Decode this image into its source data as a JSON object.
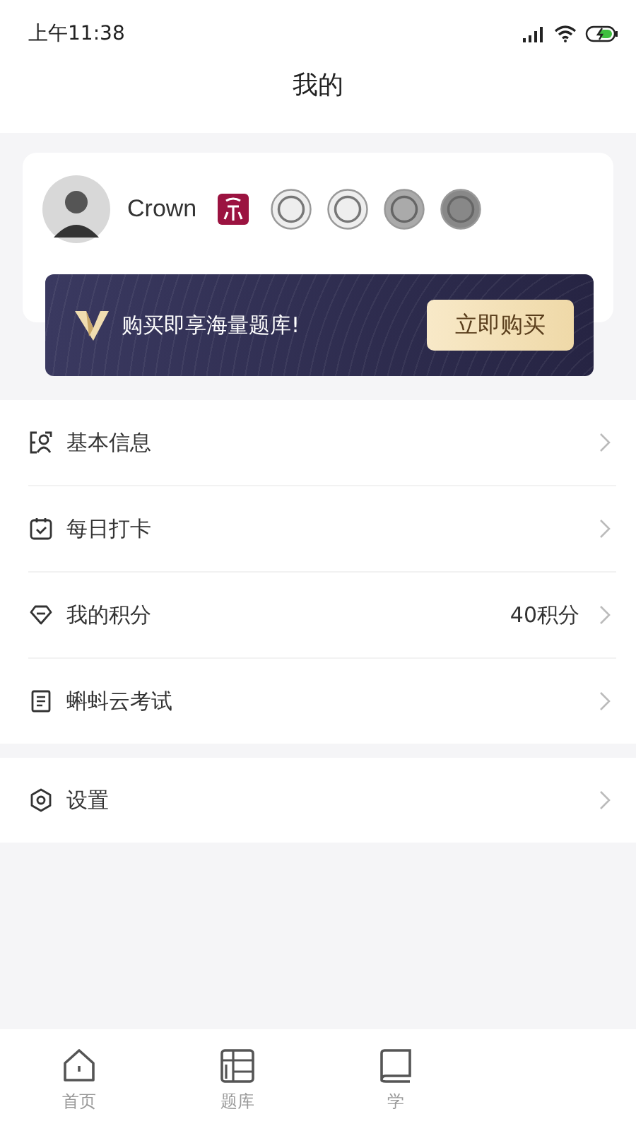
{
  "status_bar": {
    "time": "上午11:38"
  },
  "header": {
    "title": "我的"
  },
  "profile": {
    "name": "Crown",
    "badges": [
      {
        "kind": "seal"
      },
      {
        "kind": "emblem"
      },
      {
        "kind": "emblem"
      },
      {
        "kind": "emblem"
      },
      {
        "kind": "emblem"
      }
    ]
  },
  "promo": {
    "text": "购买即享海量题库!",
    "button": "立即购买"
  },
  "menu_groups": [
    [
      {
        "label": "基本信息"
      },
      {
        "label": "每日打卡"
      },
      {
        "label": "我的积分",
        "value": "40积分"
      },
      {
        "label": "蝌蚪云考试"
      }
    ],
    [
      {
        "label": "设置"
      }
    ]
  ],
  "tab_bar": [
    {
      "label": "首页",
      "selected": false
    },
    {
      "label": "题库",
      "selected": false
    },
    {
      "label": "学",
      "selected": false
    }
  ]
}
